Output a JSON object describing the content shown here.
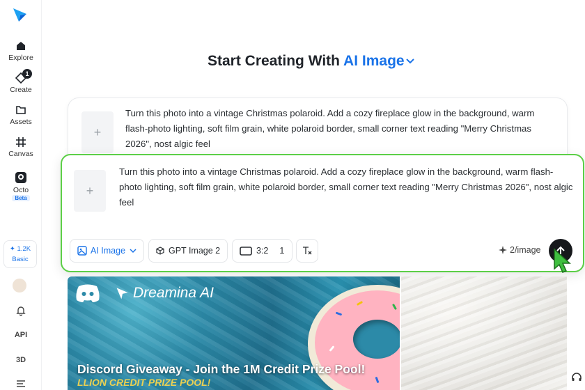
{
  "sidebar": {
    "nav": [
      {
        "label": "Explore",
        "icon": "home-icon"
      },
      {
        "label": "Create",
        "icon": "create-icon",
        "badge": "1"
      },
      {
        "label": "Assets",
        "icon": "folder-icon"
      },
      {
        "label": "Canvas",
        "icon": "canvas-icon"
      },
      {
        "label": "Octo",
        "icon": "octo-icon",
        "tag": "Beta"
      }
    ],
    "credits": {
      "amount": "1.2K",
      "plan": "Basic"
    },
    "bottom": [
      {
        "label": "",
        "icon": "bell-icon"
      },
      {
        "label": "API",
        "icon": ""
      },
      {
        "label": "3D",
        "icon": ""
      },
      {
        "label": "",
        "icon": "menu-icon"
      }
    ]
  },
  "header": {
    "title_prefix": "Start Creating With",
    "title_mode": "AI Image"
  },
  "prompt_back": {
    "text": "Turn this photo into a vintage Christmas polaroid. Add a cozy fireplace glow in the background, warm flash-photo lighting, soft film grain, white polaroid border, small corner text reading \"Merry Christmas 2026\", nost algic feel"
  },
  "prompt_front": {
    "text": "Turn this photo into a vintage Christmas polaroid. Add a cozy fireplace glow in the background, warm flash-photo lighting, soft film grain, white polaroid border, small corner text reading \"Merry Christmas 2026\", nost algic feel",
    "toolbar": {
      "mode_label": "AI Image",
      "model_label": "GPT Image 2",
      "ratio_label": "3:2",
      "count_label": "1",
      "cost_label": "2/image"
    }
  },
  "banner": {
    "brand": "Dreamina AI",
    "headline": "Discord Giveaway - Join the 1M Credit Prize Pool!",
    "sub": "LLION CREDIT PRIZE POOL!"
  },
  "colors": {
    "accent": "#1a73e8",
    "highlight_border": "#5ccf47",
    "send_button": "#16181b"
  }
}
